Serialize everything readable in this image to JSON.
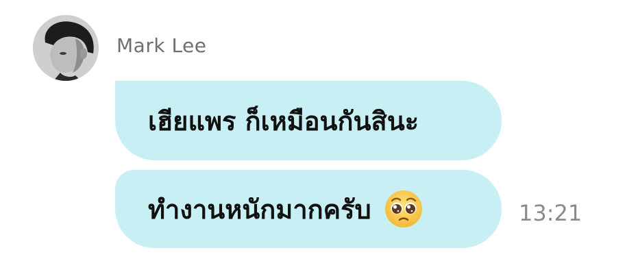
{
  "sender": {
    "name": "Mark Lee"
  },
  "messages": [
    {
      "text": "เฮียแพร ก็เหมือนกันสินะ"
    },
    {
      "text": "ทำงานหนักมากครับ",
      "emoji": "pleading-face-icon",
      "time": "13:21"
    }
  ],
  "colors": {
    "bubble_background": "#c8f0f4",
    "name_text": "#6f6f6f",
    "time_text": "#8a8a8a"
  }
}
